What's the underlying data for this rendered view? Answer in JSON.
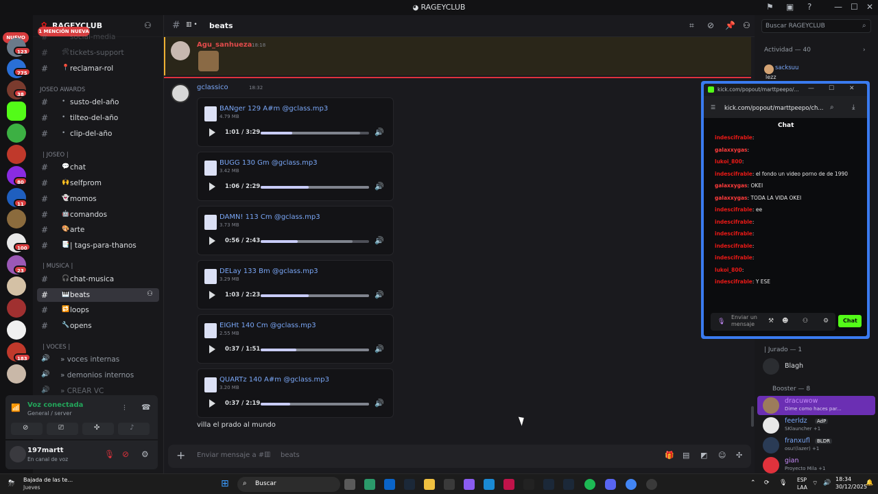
{
  "window": {
    "title": "RAGEYCLUB",
    "icon": "discord-icon"
  },
  "rail": {
    "nuevo_label": "NUEVO",
    "badges": [
      "123",
      "775",
      "38",
      "80",
      "11",
      "100",
      "23",
      "10",
      "1",
      "183",
      "21"
    ]
  },
  "server": {
    "name": "RAGEYCLUB",
    "mention_pill": "1 MENCIÓN NUEVA",
    "channels_top": [
      {
        "label": "social-media"
      },
      {
        "label": "tickets-support"
      },
      {
        "label": "reclamar-rol"
      }
    ],
    "categories": {
      "awards": "JOSEO AWARDS",
      "joseo": "| JOSEO |",
      "musica": "| MUSICA |",
      "voces": "| VOCES |"
    },
    "awards_channels": [
      {
        "label": "susto-del-año"
      },
      {
        "label": "tilteo-del-año"
      },
      {
        "label": "clip-del-año"
      }
    ],
    "joseo_channels": [
      {
        "label": "chat"
      },
      {
        "label": "selfprom"
      },
      {
        "label": "momos"
      },
      {
        "label": "comandos"
      },
      {
        "label": "arte"
      },
      {
        "label": "| tags-para-thanos"
      }
    ],
    "musica_channels": [
      {
        "label": "chat-musica"
      },
      {
        "label": "beats"
      },
      {
        "label": "loops"
      },
      {
        "label": "opens"
      }
    ],
    "voice_channels": [
      {
        "label": "» voces internas"
      },
      {
        "label": "» demonios internos"
      },
      {
        "label": "» CREAR VC"
      }
    ]
  },
  "voice": {
    "status": "Voz conectada",
    "location": "General / server"
  },
  "user": {
    "name": "197martt",
    "status": "En canal de voz"
  },
  "channel": {
    "name": "beats",
    "composer_placeholder": "Enviar mensaje a #",
    "composer_channel": "beats"
  },
  "messages": [
    {
      "author": "Agu_sanhueza",
      "time": "18:18"
    },
    {
      "author": "gclassico",
      "time": "18:32"
    }
  ],
  "attachments": [
    {
      "name": "BANger 129 A#m @gclass.mp3",
      "size": "4.79 MB",
      "time": "1:01 / 3:29",
      "progress": 0.29
    },
    {
      "name": "BUGG 130 Gm @gclass.mp3",
      "size": "3.42 MB",
      "time": "1:06 / 2:29",
      "progress": 0.44
    },
    {
      "name": "DAMN! 113 Cm @gclass.mp3",
      "size": "3.73 MB",
      "time": "0:56 / 2:43",
      "progress": 0.34
    },
    {
      "name": "DELay 133 Bm @gclass.mp3",
      "size": "3.29 MB",
      "time": "1:03 / 2:23",
      "progress": 0.44
    },
    {
      "name": "EIGHt 140 Cm @gclass.mp3",
      "size": "2.55 MB",
      "time": "0:37 / 1:51",
      "progress": 0.33
    },
    {
      "name": "QUARTz 140 A#m @gclass.mp3",
      "size": "3.20 MB",
      "time": "0:37 / 2:19",
      "progress": 0.27
    }
  ],
  "footer_text": "villa el prado al mundo",
  "search_placeholder": "Buscar RAGEYCLUB",
  "members": {
    "activity_header": "Actividad — 40",
    "activity_user": "sacksuu",
    "activity_text": "lezz",
    "jurado_header": "| Jurado — 1",
    "jurado_user": "Blagh",
    "booster_header": "Booster — 8",
    "boosters": [
      {
        "name": "dracuwow",
        "sub": "Dime como haces par..."
      },
      {
        "name": "feerldz",
        "tag": "AdP",
        "sub": "SKlauncher +1"
      },
      {
        "name": "franxufl",
        "tag": "BLDR",
        "sub": "osu!(lazer) +1"
      },
      {
        "name": "gian",
        "sub": "Proyecto Mila +1"
      }
    ]
  },
  "kick": {
    "window_title": "kick.com/popout/marttpeepo/...",
    "url": "kick.com/popout/marttpeepo/ch...",
    "chat_title": "Chat",
    "messages": [
      {
        "user": "indescifrable",
        "text": "",
        "color": "#e91916"
      },
      {
        "user": "galaxxygas",
        "text": "",
        "color": "#ff3b3b"
      },
      {
        "user": "lukoi_800",
        "text": "",
        "color": "#e91916"
      },
      {
        "user": "indescifrable",
        "text": "el fondo un video porno de de 1990",
        "color": "#e91916"
      },
      {
        "user": "galaxxygas",
        "text": "OKEI",
        "color": "#ff3b3b"
      },
      {
        "user": "galaxxygas",
        "text": "TODA LA VIDA OKEI",
        "color": "#ff3b3b"
      },
      {
        "user": "indescifrable",
        "text": "ee",
        "color": "#e91916"
      },
      {
        "user": "indescifrable",
        "text": "",
        "color": "#e91916"
      },
      {
        "user": "indescifrable",
        "text": "",
        "color": "#e91916"
      },
      {
        "user": "indescifrable",
        "text": "",
        "color": "#e91916"
      },
      {
        "user": "indescifrable",
        "text": "",
        "color": "#e91916"
      },
      {
        "user": "lukoi_800",
        "text": "",
        "color": "#e91916"
      },
      {
        "user": "indescifrable",
        "text": "Y ESE",
        "color": "#e91916"
      }
    ],
    "input_placeholder": "Enviar un mensaje",
    "send_label": "Chat",
    "accent": "#53fc18"
  },
  "taskbar": {
    "weather_title": "Bajada de las te...",
    "weather_sub": "Jueves",
    "search_label": "Buscar",
    "lang": "ESP",
    "lang_sub": "LAA",
    "time": "18:34",
    "date": "30/12/2025"
  },
  "colors": {
    "mention_red": "#d83c3e",
    "link_blue": "#7aa7f7",
    "discord_bg": "#1a1a1e"
  }
}
